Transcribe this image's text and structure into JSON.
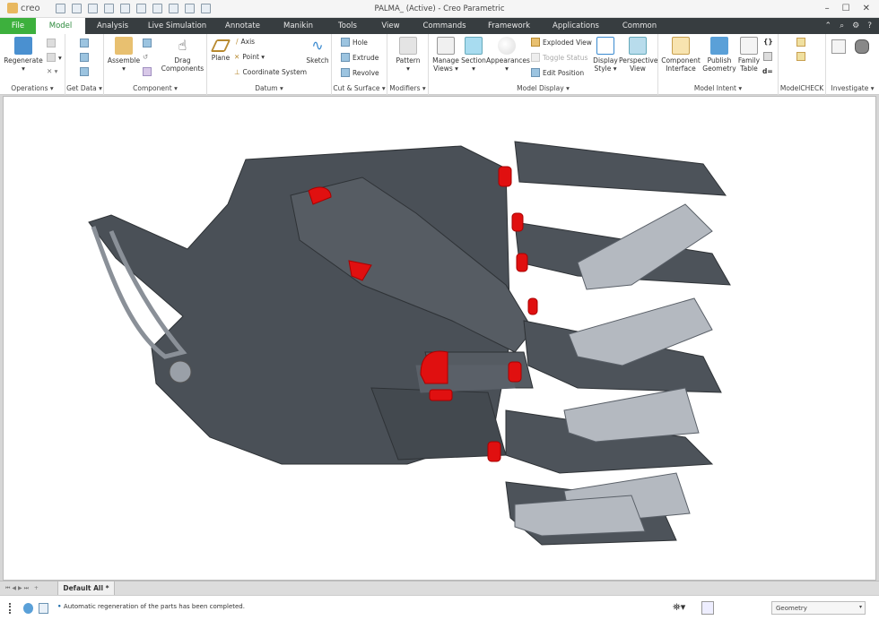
{
  "titlebar": {
    "logo": "creo",
    "title": "PALMA_ (Active) - Creo Parametric",
    "minimize": "–",
    "maximize": "☐",
    "close": "✕"
  },
  "tabs": [
    "File",
    "Model",
    "Analysis",
    "Live Simulation",
    "Annotate",
    "Manikin",
    "Tools",
    "View",
    "Commands",
    "Framework",
    "Applications",
    "Common"
  ],
  "ribbon": {
    "operations": {
      "label": "Operations ▾",
      "regenerate": "Regenerate"
    },
    "get_data": {
      "label": "Get Data ▾"
    },
    "component": {
      "label": "Component ▾",
      "assemble": "Assemble",
      "drag": "Drag Components"
    },
    "datum": {
      "label": "Datum ▾",
      "plane": "Plane",
      "axis": "Axis",
      "point": "Point ▾",
      "csys": "Coordinate System",
      "sketch": "Sketch"
    },
    "cut_surface": {
      "label": "Cut & Surface ▾",
      "hole": "Hole",
      "extrude": "Extrude",
      "revolve": "Revolve"
    },
    "modifiers": {
      "label": "Modifiers ▾",
      "pattern": "Pattern"
    },
    "model_display": {
      "label": "Model Display ▾",
      "manage_views": "Manage Views ▾",
      "section": "Section",
      "appearances": "Appearances",
      "exploded": "Exploded View",
      "toggle": "Toggle Status",
      "edit_position": "Edit Position",
      "display_style": "Display Style ▾",
      "perspective": "Perspective View"
    },
    "model_intent": {
      "label": "Model Intent ▾",
      "component_interface": "Component Interface",
      "publish": "Publish Geometry",
      "family": "Family Table",
      "d_eq": "d="
    },
    "modelcheck": {
      "label": "ModelCHECK"
    },
    "investigate": {
      "label": "Investigate ▾"
    }
  },
  "model_tabs": {
    "active": "Default All *"
  },
  "status": {
    "message": "Automatic regeneration of the parts has been completed.",
    "filter": "Geometry"
  },
  "colors": {
    "tabbar": "#373d40",
    "file_tab": "#3db03d",
    "model_dark": "#4a5057",
    "accent_red": "#e01010"
  }
}
